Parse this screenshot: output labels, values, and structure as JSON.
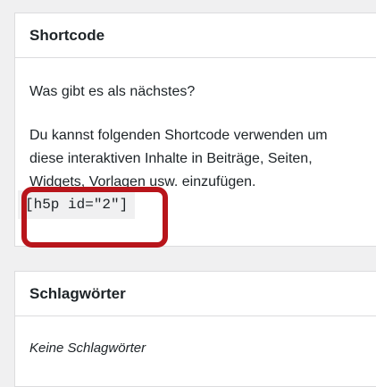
{
  "shortcode_panel": {
    "title": "Shortcode",
    "whats_next": "Was gibt es als nächstes?",
    "description": "Du kannst folgenden Shortcode verwenden um diese interaktiven Inhalte in Beiträge, Seiten, Widgets, Vorlagen usw. einzufügen.",
    "shortcode": "[h5p id=\"2\"]"
  },
  "tags_panel": {
    "title": "Schlagwörter",
    "empty_text": "Keine Schlagwörter"
  },
  "colors": {
    "highlight": "#b8151b",
    "panel_background": "#ffffff",
    "page_background": "#f0f0f1",
    "code_background": "#f0f0f1"
  }
}
